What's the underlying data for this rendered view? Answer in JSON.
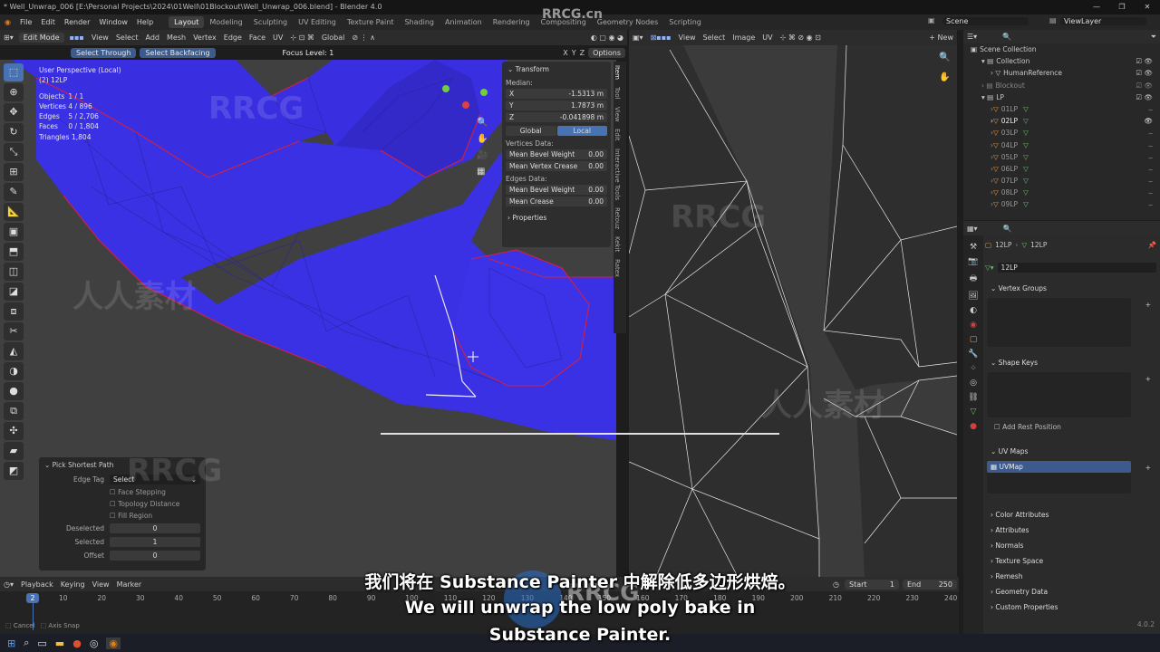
{
  "window": {
    "title": "* Well_Unwrap_006 [E:\\Personal Projects\\2024\\01Well\\01Blockout\\Well_Unwrap_006.blend] - Blender 4.0",
    "controls": [
      "—",
      "❐",
      "✕"
    ]
  },
  "menu": [
    "File",
    "Edit",
    "Render",
    "Window",
    "Help"
  ],
  "workspaces": [
    "Layout",
    "Modeling",
    "Sculpting",
    "UV Editing",
    "Texture Paint",
    "Shading",
    "Animation",
    "Rendering",
    "Compositing",
    "Geometry Nodes",
    "Scripting"
  ],
  "active_workspace": "Layout",
  "scene": {
    "name": "Scene",
    "viewlayer": "ViewLayer"
  },
  "viewport_header": {
    "mode": "Edit Mode",
    "items": [
      "View",
      "Select",
      "Add",
      "Mesh",
      "Vertex",
      "Edge",
      "Face",
      "UV"
    ],
    "orientation": "Global"
  },
  "viewport_subheader": {
    "select_through": "Select Through",
    "select_backfacing": "Select Backfacing",
    "focus": "Focus Level: 1",
    "options": "Options",
    "axes": [
      "X",
      "Y",
      "Z"
    ]
  },
  "viewport_info": {
    "view": "User Perspective (Local)",
    "object": "(2) 12LP",
    "stats": [
      {
        "k": "Objects",
        "v": "1 / 1"
      },
      {
        "k": "Vertices",
        "v": "4 / 896"
      },
      {
        "k": "Edges",
        "v": "5 / 2,706"
      },
      {
        "k": "Faces",
        "v": "0 / 1,804"
      },
      {
        "k": "Triangles",
        "v": "1,804"
      }
    ]
  },
  "npanel": {
    "title": "Transform",
    "median": "Median:",
    "x": "-1.5313 m",
    "y": "1.7873 m",
    "z": "-0.041898 m",
    "global": "Global",
    "local": "Local",
    "vertices_data": "Vertices Data:",
    "mean_bevel_weight": "Mean Bevel Weight",
    "mean_vertex_crease": "Mean Vertex Crease",
    "edges_data": "Edges Data:",
    "mean_bevel_weight_e": "Mean Bevel Weight",
    "mean_crease": "Mean Crease",
    "zero": "0.00",
    "properties": "Properties"
  },
  "ntabs": [
    "Item",
    "Tool",
    "View",
    "Edit",
    "Interactive Tools",
    "Retouz",
    "Kekit",
    "Ratex"
  ],
  "redo_panel": {
    "title": "Pick Shortest Path",
    "edge_tag_label": "Edge Tag",
    "edge_tag_value": "Select",
    "face_stepping": "Face Stepping",
    "topology_distance": "Topology Distance",
    "fill_region": "Fill Region",
    "deselected_label": "Deselected",
    "deselected_value": "0",
    "selected_label": "Selected",
    "selected_value": "1",
    "offset_label": "Offset",
    "offset_value": "0"
  },
  "uv_header": {
    "items": [
      "View",
      "Select",
      "Image",
      "UV"
    ],
    "new": "New"
  },
  "outliner": {
    "scene_collection": "Scene Collection",
    "rows": [
      "Collection",
      "HumanReference",
      "Blockout",
      "LP",
      "01LP",
      "02LP",
      "03LP",
      "04LP",
      "05LP",
      "06LP",
      "07LP",
      "08LP",
      "09LP"
    ]
  },
  "properties": {
    "breadcrumb_a": "12LP",
    "breadcrumb_b": "12LP",
    "mesh_name": "12LP",
    "vertex_groups": "Vertex Groups",
    "shape_keys": "Shape Keys",
    "add_rest_position": "Add Rest Position",
    "uv_maps": "UV Maps",
    "uvmap": "UVMap",
    "sections": [
      "Color Attributes",
      "Attributes",
      "Normals",
      "Texture Space",
      "Remesh",
      "Geometry Data",
      "Custom Properties"
    ],
    "version": "4.0.2"
  },
  "timeline": {
    "items": [
      "Playback",
      "Keying",
      "View",
      "Marker"
    ],
    "current_frame": "2",
    "start_label": "Start",
    "start": "1",
    "end_label": "End",
    "end": "250",
    "ticks": [
      "10",
      "20",
      "30",
      "40",
      "50",
      "60",
      "70",
      "80",
      "90",
      "100",
      "110",
      "120",
      "130",
      "140",
      "150",
      "160",
      "170",
      "180",
      "190",
      "200",
      "210",
      "220",
      "230",
      "240"
    ]
  },
  "status": {
    "cancel": "Cancel",
    "axis_snap": "Axis Snap"
  },
  "subtitles": {
    "cn": "我们将在 Substance Painter 中解除低多边形烘焙。",
    "en1": "We will unwrap the low poly bake in",
    "en2": "Substance Painter."
  },
  "watermark": {
    "brand": "RRCG",
    "cn": "人人素材",
    "logo": "RRCG.cn"
  },
  "colors": {
    "mesh": "#3a2fe0",
    "seam": "#c8203a",
    "accent": "#4772b3",
    "uv_bg": "#3b3b3b"
  }
}
